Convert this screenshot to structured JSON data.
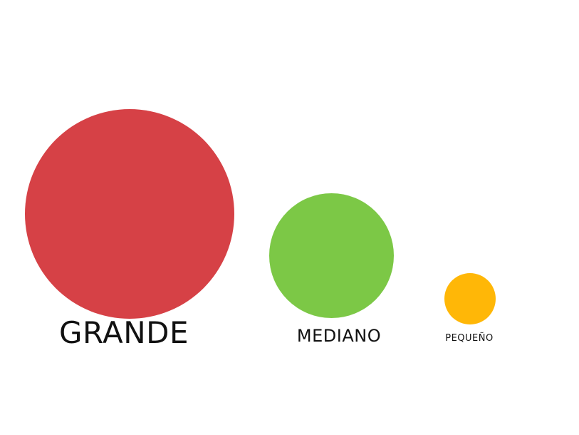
{
  "circles": {
    "large": {
      "label": "GRANDE",
      "color": "#d64146"
    },
    "medium": {
      "label": "MEDIANO",
      "color": "#7cc846"
    },
    "small": {
      "label": "PEQUEÑO",
      "color": "#ffb707"
    }
  }
}
